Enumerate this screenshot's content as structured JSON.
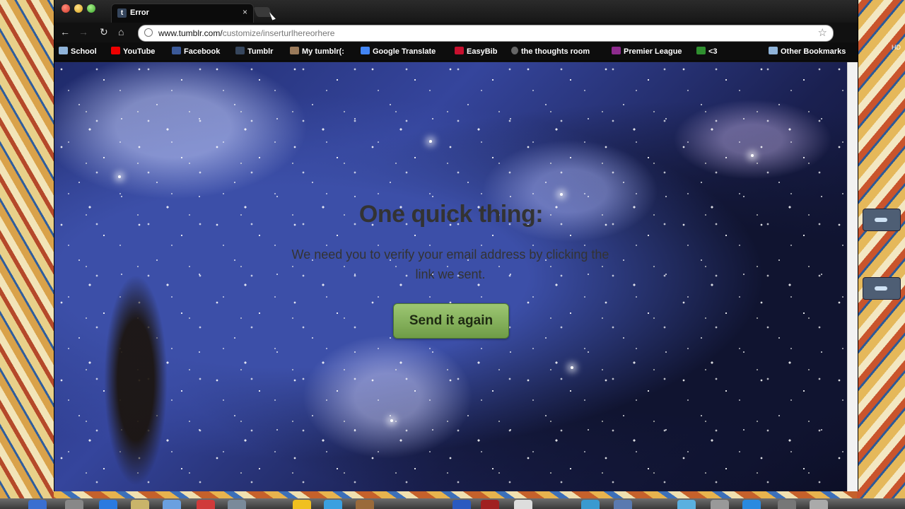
{
  "browser": {
    "tab": {
      "favicon": "t",
      "title": "Error",
      "close": "×"
    },
    "toolbar": {
      "back": "←",
      "forward": "→",
      "reload": "↻",
      "home": "⌂",
      "url_host": "www.tumblr.com/",
      "url_path": "customize/inserturlhereorhere",
      "star": "☆"
    },
    "wrench": "🔧",
    "bookmarks": [
      {
        "label": "School",
        "icon": "folder-icon"
      },
      {
        "label": "YouTube",
        "icon": "youtube-icon"
      },
      {
        "label": "Facebook",
        "icon": "facebook-icon"
      },
      {
        "label": "Tumblr",
        "icon": "tumblr-icon"
      },
      {
        "label": "My tumblr(:",
        "icon": "avatar-icon"
      },
      {
        "label": "Google Translate",
        "icon": "translate-icon"
      },
      {
        "label": "EasyBib",
        "icon": "easybib-icon"
      },
      {
        "label": "the thoughts room",
        "icon": "thought-icon"
      },
      {
        "label": "Premier League",
        "icon": "premier-league-icon"
      },
      {
        "label": "<3",
        "icon": "heart-icon"
      },
      {
        "label": "Other Bookmarks",
        "icon": "folder-icon"
      }
    ]
  },
  "page": {
    "heading": "One quick thing:",
    "message": "We need you to verify your email address by clicking the link we sent.",
    "button_label": "Send it again"
  },
  "desktop": {
    "side_label": "HD"
  }
}
